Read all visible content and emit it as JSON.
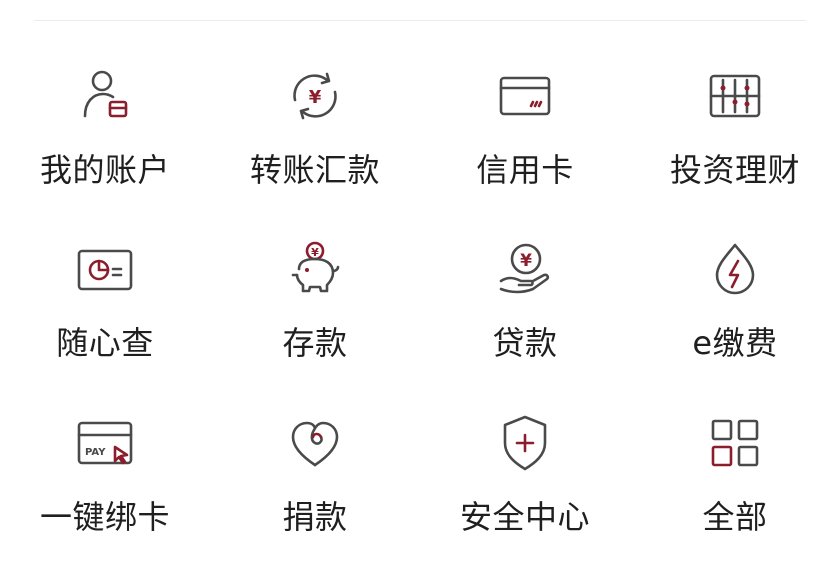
{
  "colors": {
    "accent": "#8b1e2d",
    "icon_stroke": "#4a4a4a",
    "text": "#1f1f1f"
  },
  "menu": {
    "items": [
      {
        "label": "我的账户",
        "icon": "account-icon"
      },
      {
        "label": "转账汇款",
        "icon": "transfer-icon"
      },
      {
        "label": "信用卡",
        "icon": "credit-card-icon"
      },
      {
        "label": "投资理财",
        "icon": "investment-icon"
      },
      {
        "label": "随心查",
        "icon": "query-icon"
      },
      {
        "label": "存款",
        "icon": "piggy-bank-icon"
      },
      {
        "label": "贷款",
        "icon": "loan-icon"
      },
      {
        "label": "e缴费",
        "icon": "payment-drop-icon"
      },
      {
        "label": "一键绑卡",
        "icon": "bind-card-icon"
      },
      {
        "label": "捐款",
        "icon": "donation-heart-icon"
      },
      {
        "label": "安全中心",
        "icon": "shield-icon"
      },
      {
        "label": "全部",
        "icon": "grid-icon"
      }
    ]
  },
  "icon_text": {
    "yuan": "¥",
    "pay": "PAY"
  }
}
